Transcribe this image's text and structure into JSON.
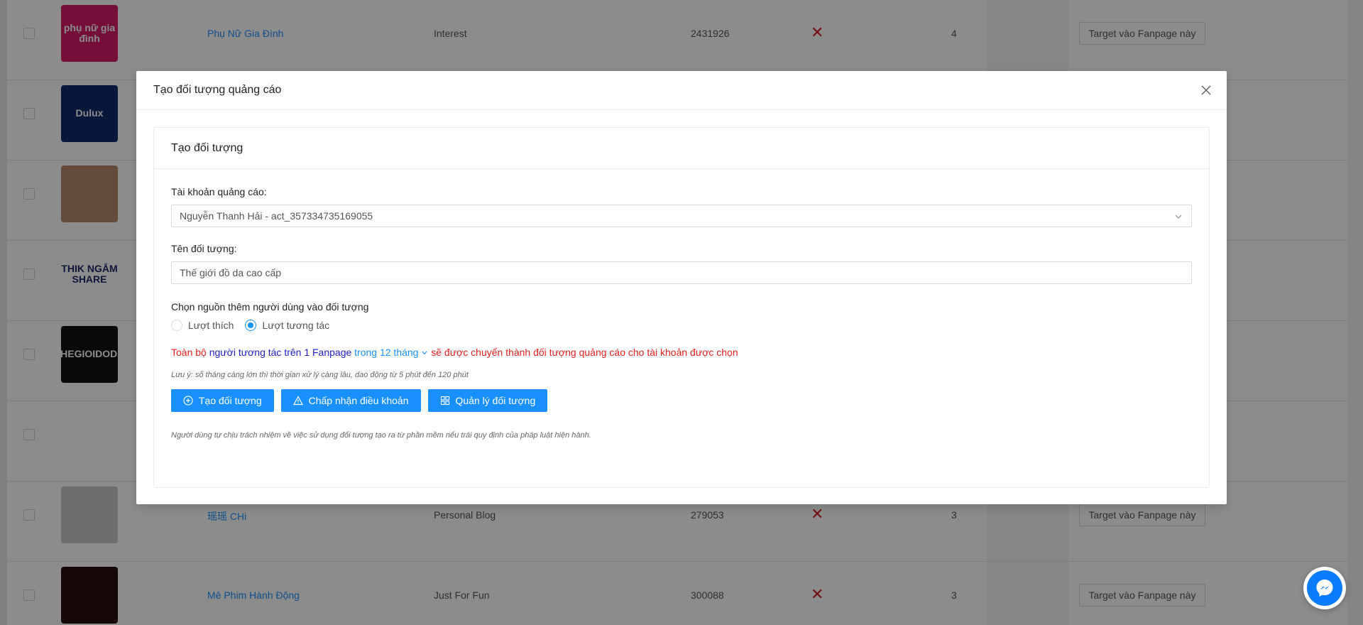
{
  "background_table": {
    "rows": [
      {
        "name": "Phụ Nữ Gia Đình",
        "category": "Interest",
        "followers": "2431926",
        "count": "4",
        "button": "Target vào Fanpage này",
        "avatar_text": "phụ nữ gia đình",
        "avatar_color": "#d81b6a"
      },
      {
        "name": "",
        "category": "",
        "followers": "",
        "count": "",
        "button": "",
        "avatar_text": "Dulux",
        "avatar_color": "#0b2a6b"
      },
      {
        "name": "",
        "category": "",
        "followers": "",
        "count": "",
        "button": "",
        "avatar_text": "",
        "avatar_color": "#b98a6a"
      },
      {
        "name": "",
        "category": "",
        "followers": "",
        "count": "",
        "button": "",
        "avatar_text": "THIK NGẮM SHARE",
        "avatar_color": "#ffffff"
      },
      {
        "name": "",
        "category": "",
        "followers": "",
        "count": "",
        "button": "",
        "avatar_text": "THEGIOIDODA",
        "avatar_color": "#111111"
      },
      {
        "name": "",
        "category": "",
        "followers": "",
        "count": "",
        "button": "",
        "avatar_text": "",
        "avatar_color": "#ffffff"
      },
      {
        "name": "瑶瑶 CHi",
        "category": "Personal Blog",
        "followers": "279053",
        "count": "3",
        "button": "Target vào Fanpage này",
        "avatar_text": "",
        "avatar_color": "#c9c9c9"
      },
      {
        "name": "Mê Phim Hành Động",
        "category": "Just For Fun",
        "followers": "300088",
        "count": "3",
        "button": "Target vào Fanpage này",
        "avatar_text": "",
        "avatar_color": "#2a0c0c"
      }
    ]
  },
  "modal": {
    "title": "Tạo đối tượng quảng cáo",
    "card_title": "Tạo đối tượng",
    "ad_account_label": "Tài khoản quảng cáo:",
    "ad_account_value": "Nguyễn Thanh Hải - act_357334735169055",
    "audience_name_label": "Tên đối tượng:",
    "audience_name_value": "Thế giới đồ da cao cấp",
    "source_label": "Chọn nguồn thêm người dùng vào đối tượng",
    "radio_likes": "Lượt thích",
    "radio_interactions": "Lượt tương tác",
    "notice": {
      "part1": "Toàn bộ ",
      "part2": "người tương tác trên 1 Fanpage",
      "part3": " trong 12 tháng",
      "part4": " sẽ được chuyển thành đối tượng quảng cáo cho tài khoản được chọn"
    },
    "note_small": "Lưu ý: số tháng càng lớn thì thời gian xử lý càng lâu, dao động từ 5 phút đến 120 phút",
    "buttons": {
      "create": "Tạo đối tượng",
      "accept_terms": "Chấp nhận điều khoản",
      "manage": "Quản lý đối tượng"
    },
    "disclaimer": "Người dùng tự chịu trách nhiệm về việc sử dụng đối tượng tạo ra từ phần mềm nếu trái quy định của pháp luật hiện hành."
  },
  "colors": {
    "primary": "#1890ff",
    "danger": "#e8201e",
    "messenger": "#0a7cff"
  }
}
